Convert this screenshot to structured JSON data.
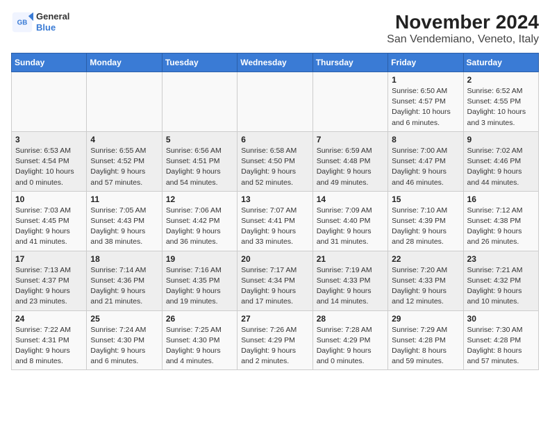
{
  "logo": {
    "general": "General",
    "blue": "Blue"
  },
  "title": "November 2024",
  "subtitle": "San Vendemiano, Veneto, Italy",
  "weekdays": [
    "Sunday",
    "Monday",
    "Tuesday",
    "Wednesday",
    "Thursday",
    "Friday",
    "Saturday"
  ],
  "weeks": [
    [
      {
        "day": "",
        "info": ""
      },
      {
        "day": "",
        "info": ""
      },
      {
        "day": "",
        "info": ""
      },
      {
        "day": "",
        "info": ""
      },
      {
        "day": "",
        "info": ""
      },
      {
        "day": "1",
        "info": "Sunrise: 6:50 AM\nSunset: 4:57 PM\nDaylight: 10 hours\nand 6 minutes."
      },
      {
        "day": "2",
        "info": "Sunrise: 6:52 AM\nSunset: 4:55 PM\nDaylight: 10 hours\nand 3 minutes."
      }
    ],
    [
      {
        "day": "3",
        "info": "Sunrise: 6:53 AM\nSunset: 4:54 PM\nDaylight: 10 hours\nand 0 minutes."
      },
      {
        "day": "4",
        "info": "Sunrise: 6:55 AM\nSunset: 4:52 PM\nDaylight: 9 hours\nand 57 minutes."
      },
      {
        "day": "5",
        "info": "Sunrise: 6:56 AM\nSunset: 4:51 PM\nDaylight: 9 hours\nand 54 minutes."
      },
      {
        "day": "6",
        "info": "Sunrise: 6:58 AM\nSunset: 4:50 PM\nDaylight: 9 hours\nand 52 minutes."
      },
      {
        "day": "7",
        "info": "Sunrise: 6:59 AM\nSunset: 4:48 PM\nDaylight: 9 hours\nand 49 minutes."
      },
      {
        "day": "8",
        "info": "Sunrise: 7:00 AM\nSunset: 4:47 PM\nDaylight: 9 hours\nand 46 minutes."
      },
      {
        "day": "9",
        "info": "Sunrise: 7:02 AM\nSunset: 4:46 PM\nDaylight: 9 hours\nand 44 minutes."
      }
    ],
    [
      {
        "day": "10",
        "info": "Sunrise: 7:03 AM\nSunset: 4:45 PM\nDaylight: 9 hours\nand 41 minutes."
      },
      {
        "day": "11",
        "info": "Sunrise: 7:05 AM\nSunset: 4:43 PM\nDaylight: 9 hours\nand 38 minutes."
      },
      {
        "day": "12",
        "info": "Sunrise: 7:06 AM\nSunset: 4:42 PM\nDaylight: 9 hours\nand 36 minutes."
      },
      {
        "day": "13",
        "info": "Sunrise: 7:07 AM\nSunset: 4:41 PM\nDaylight: 9 hours\nand 33 minutes."
      },
      {
        "day": "14",
        "info": "Sunrise: 7:09 AM\nSunset: 4:40 PM\nDaylight: 9 hours\nand 31 minutes."
      },
      {
        "day": "15",
        "info": "Sunrise: 7:10 AM\nSunset: 4:39 PM\nDaylight: 9 hours\nand 28 minutes."
      },
      {
        "day": "16",
        "info": "Sunrise: 7:12 AM\nSunset: 4:38 PM\nDaylight: 9 hours\nand 26 minutes."
      }
    ],
    [
      {
        "day": "17",
        "info": "Sunrise: 7:13 AM\nSunset: 4:37 PM\nDaylight: 9 hours\nand 23 minutes."
      },
      {
        "day": "18",
        "info": "Sunrise: 7:14 AM\nSunset: 4:36 PM\nDaylight: 9 hours\nand 21 minutes."
      },
      {
        "day": "19",
        "info": "Sunrise: 7:16 AM\nSunset: 4:35 PM\nDaylight: 9 hours\nand 19 minutes."
      },
      {
        "day": "20",
        "info": "Sunrise: 7:17 AM\nSunset: 4:34 PM\nDaylight: 9 hours\nand 17 minutes."
      },
      {
        "day": "21",
        "info": "Sunrise: 7:19 AM\nSunset: 4:33 PM\nDaylight: 9 hours\nand 14 minutes."
      },
      {
        "day": "22",
        "info": "Sunrise: 7:20 AM\nSunset: 4:33 PM\nDaylight: 9 hours\nand 12 minutes."
      },
      {
        "day": "23",
        "info": "Sunrise: 7:21 AM\nSunset: 4:32 PM\nDaylight: 9 hours\nand 10 minutes."
      }
    ],
    [
      {
        "day": "24",
        "info": "Sunrise: 7:22 AM\nSunset: 4:31 PM\nDaylight: 9 hours\nand 8 minutes."
      },
      {
        "day": "25",
        "info": "Sunrise: 7:24 AM\nSunset: 4:30 PM\nDaylight: 9 hours\nand 6 minutes."
      },
      {
        "day": "26",
        "info": "Sunrise: 7:25 AM\nSunset: 4:30 PM\nDaylight: 9 hours\nand 4 minutes."
      },
      {
        "day": "27",
        "info": "Sunrise: 7:26 AM\nSunset: 4:29 PM\nDaylight: 9 hours\nand 2 minutes."
      },
      {
        "day": "28",
        "info": "Sunrise: 7:28 AM\nSunset: 4:29 PM\nDaylight: 9 hours\nand 0 minutes."
      },
      {
        "day": "29",
        "info": "Sunrise: 7:29 AM\nSunset: 4:28 PM\nDaylight: 8 hours\nand 59 minutes."
      },
      {
        "day": "30",
        "info": "Sunrise: 7:30 AM\nSunset: 4:28 PM\nDaylight: 8 hours\nand 57 minutes."
      }
    ]
  ]
}
